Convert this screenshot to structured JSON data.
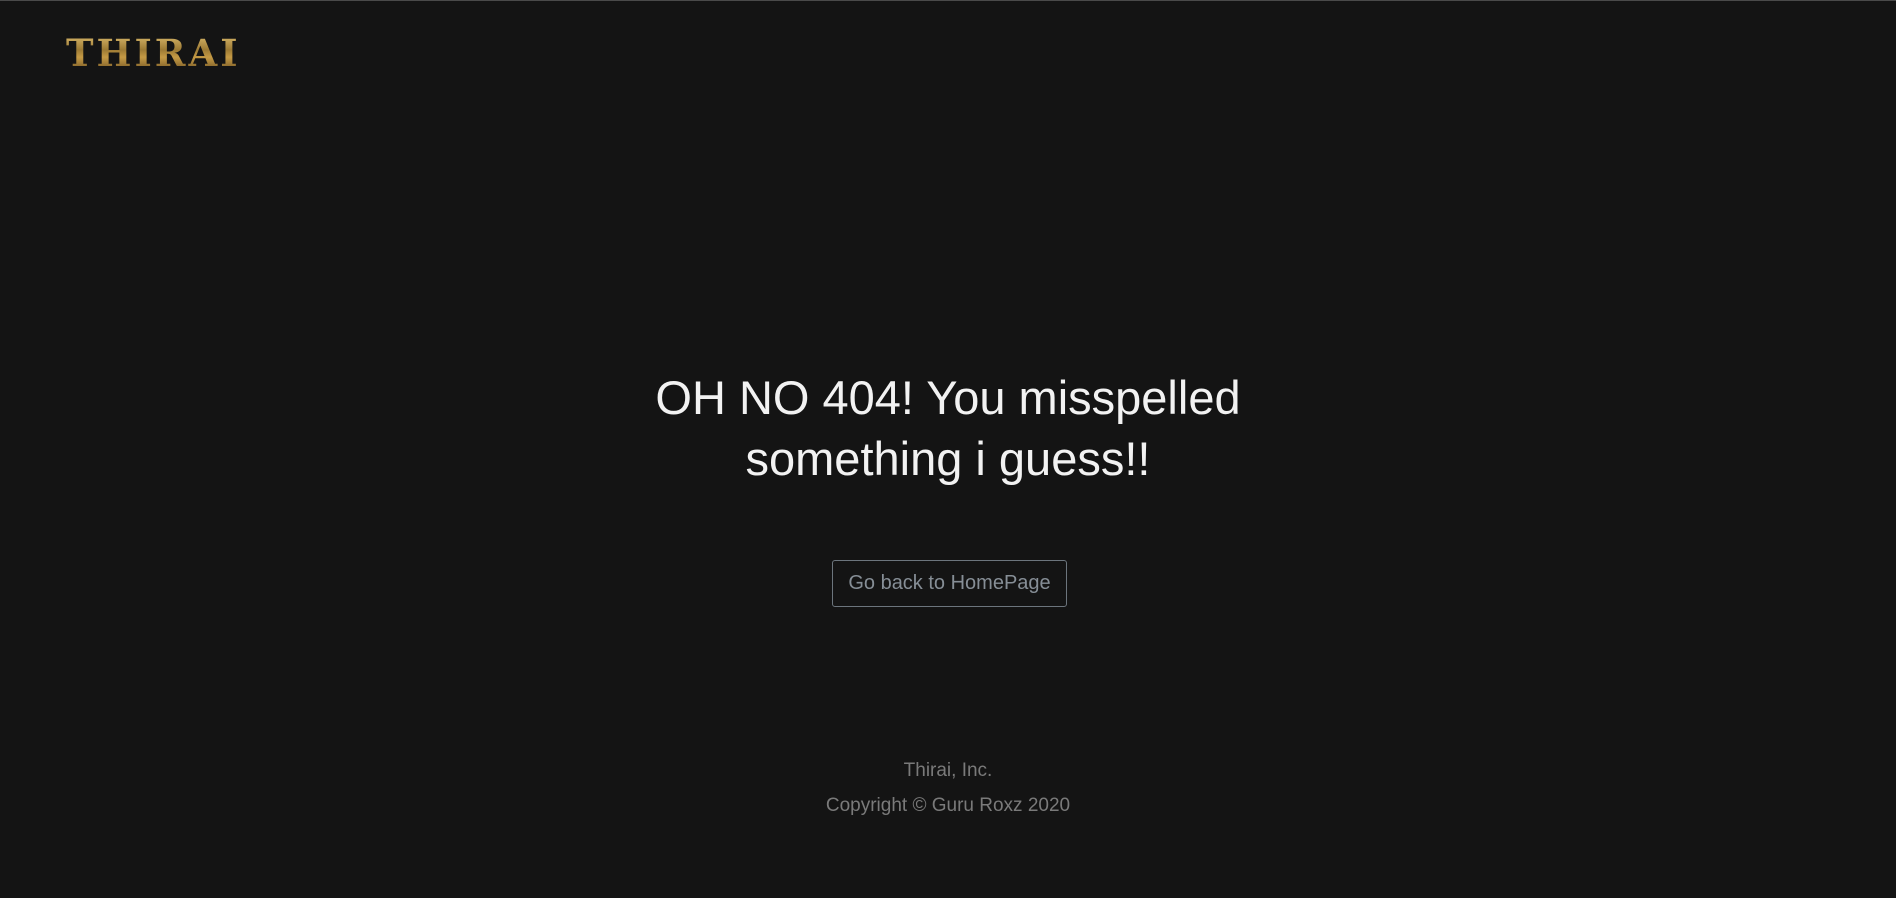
{
  "header": {
    "logo_text": "THIRAI"
  },
  "main": {
    "headline_line1": "OH NO 404! You misspelled",
    "headline_line2": "something i guess!!",
    "home_button_label": "Go back to HomePage"
  },
  "footer": {
    "company": "Thirai, Inc.",
    "copyright": "Copyright © Guru Roxz 2020"
  },
  "colors": {
    "background": "#141414",
    "logo_gold": "#b8923f",
    "headline": "#f2f2f2",
    "button_border": "#6c757d",
    "footer_text": "#7a7a7a"
  }
}
